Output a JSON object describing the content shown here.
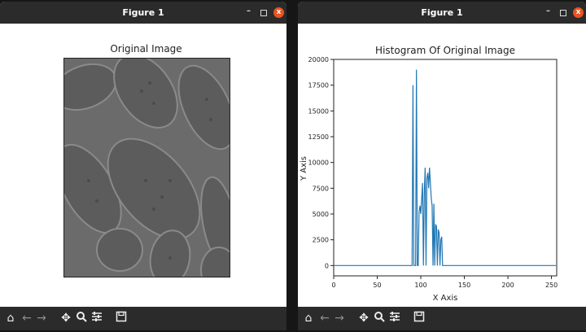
{
  "windows": [
    {
      "title": "Figure 1",
      "plot_title": "Original Image"
    },
    {
      "title": "Figure 1",
      "plot_title": "Histogram Of Original Image"
    }
  ],
  "window_controls": {
    "minimize": "–",
    "close": "x"
  },
  "toolbar_icons": [
    "home-icon",
    "back-arrow-icon",
    "forward-arrow-icon",
    "pan-icon",
    "zoom-icon",
    "configure-subplots-icon",
    "save-icon"
  ],
  "colors": {
    "titlebar": "#2b2b2b",
    "close": "#e95420",
    "line": "#1f77b4"
  },
  "chart_data": {
    "type": "line",
    "title": "Histogram Of Original Image",
    "xlabel": "X Axis",
    "ylabel": "Y Axis",
    "xlim": [
      0,
      256
    ],
    "ylim": [
      -1000,
      20000
    ],
    "xticks": [
      0,
      50,
      100,
      150,
      200,
      250
    ],
    "xtick_labels": [
      "0",
      "50",
      "100",
      "150",
      "200",
      "250"
    ],
    "yticks": [
      0,
      2500,
      5000,
      7500,
      10000,
      12500,
      15000,
      17500,
      20000
    ],
    "ytick_labels": [
      "0",
      "2500",
      "5000",
      "7500",
      "10000",
      "12500",
      "15000",
      "17500",
      "20000"
    ],
    "series": [
      {
        "x": [
          0,
          88,
          89,
          90,
          91,
          92,
          93,
          94,
          95,
          96,
          97,
          98,
          99,
          100,
          101,
          102,
          103,
          104,
          105,
          106,
          107,
          108,
          109,
          110,
          111,
          112,
          113,
          114,
          115,
          116,
          117,
          118,
          119,
          120,
          121,
          122,
          123,
          124,
          125,
          126,
          127,
          128,
          129,
          130,
          131,
          132,
          133,
          134,
          135,
          255
        ],
        "y": [
          0,
          0,
          0,
          0,
          17500,
          0,
          0,
          0,
          19000,
          0,
          0,
          5200,
          5800,
          5000,
          6500,
          8000,
          0,
          7000,
          9500,
          0,
          8500,
          9000,
          7500,
          9500,
          8000,
          6500,
          5800,
          0,
          6000,
          0,
          4000,
          3800,
          0,
          3500,
          3200,
          0,
          2500,
          2800,
          0,
          0,
          0,
          0,
          0,
          0,
          0,
          0,
          0,
          0,
          0,
          0
        ]
      }
    ],
    "grid": false
  }
}
